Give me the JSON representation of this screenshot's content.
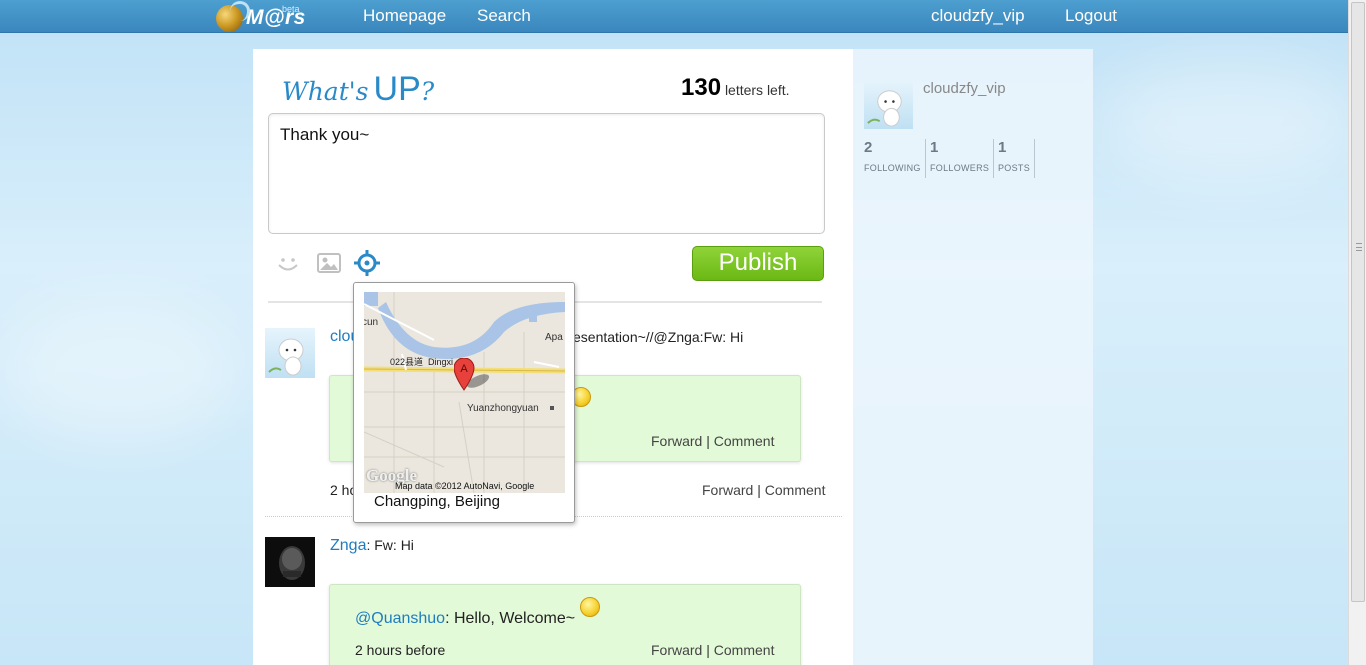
{
  "nav": {
    "logo_text": "M@rs",
    "logo_badge": "beta",
    "homepage": "Homepage",
    "search": "Search",
    "username": "cloudzfy_vip",
    "logout": "Logout"
  },
  "composer": {
    "title_small_1": "What's",
    "title_big": "UP",
    "title_small_2": "?",
    "letters_count": "130",
    "letters_label": "letters left.",
    "textarea_value": "Thank you~",
    "publish_label": "Publish"
  },
  "map_popup": {
    "marker_letter": "A",
    "labels": {
      "road": "022县道",
      "road2": "Dingxi",
      "place": "Yuanzhongyuan",
      "left_cut": "cun",
      "right_cut": "Apa"
    },
    "google_logo": "Google",
    "attribution": "Map data ©2012 AutoNavi, Google",
    "caption": "Changping, Beijing"
  },
  "feed": [
    {
      "user_visible": "clou",
      "text_visible": "esentation~//@Znga:Fw: Hi",
      "quote_actions": {
        "forward": "Forward",
        "sep": "|",
        "comment": "Comment"
      },
      "time_visible": "2 ho",
      "actions": {
        "forward": "Forward",
        "sep": "|",
        "comment": "Comment"
      }
    },
    {
      "user": "Znga",
      "text": ": Fw: Hi",
      "quote": {
        "mention": "@Quanshuo",
        "text": ": Hello, Welcome~",
        "time": "2 hours before"
      },
      "quote_actions": {
        "forward": "Forward",
        "sep": "|",
        "comment": "Comment"
      }
    }
  ],
  "profile": {
    "name": "cloudzfy_vip",
    "stats": [
      {
        "num": "2",
        "label": "FOLLOWING"
      },
      {
        "num": "1",
        "label": "FOLLOWERS"
      },
      {
        "num": "1",
        "label": "POSTS"
      }
    ]
  },
  "colors": {
    "topbar": "#3a87bd",
    "accent_blue": "#2a8ac8",
    "publish_green": "#6bb813",
    "quote_bg": "#e3fad8"
  },
  "icons": [
    "smiley-icon",
    "image-icon",
    "location-icon",
    "map-marker-icon"
  ]
}
